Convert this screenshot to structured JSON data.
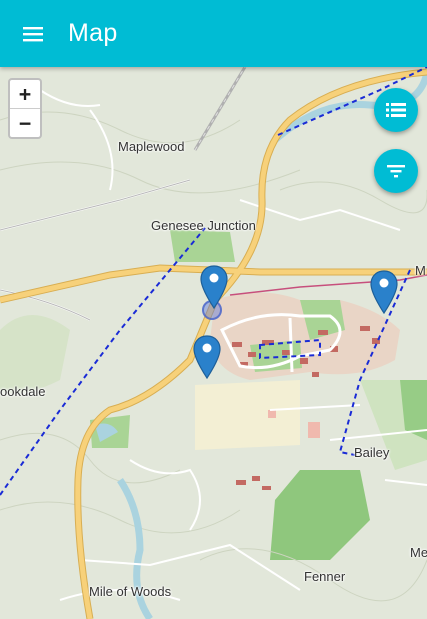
{
  "header": {
    "title": "Map",
    "menu_icon": "hamburger-menu-icon"
  },
  "zoom": {
    "in_label": "+",
    "out_label": "−"
  },
  "fabs": {
    "list_icon": "list-icon",
    "filter_icon": "filter-icon"
  },
  "places": {
    "maplewood": "Maplewood",
    "genesee_junction": "Genesee Junction",
    "ookdale": "ookdale",
    "bailey": "Bailey",
    "fenner": "Fenner",
    "mile_of_woods": "Mile of Woods",
    "edge_m": "M",
    "edge_me": "Me"
  },
  "colors": {
    "appbar": "#00bcd4",
    "marker": "#2a81cb",
    "route": "#1a2bd6",
    "water": "#aad3df",
    "highway": "#f7d17a"
  }
}
